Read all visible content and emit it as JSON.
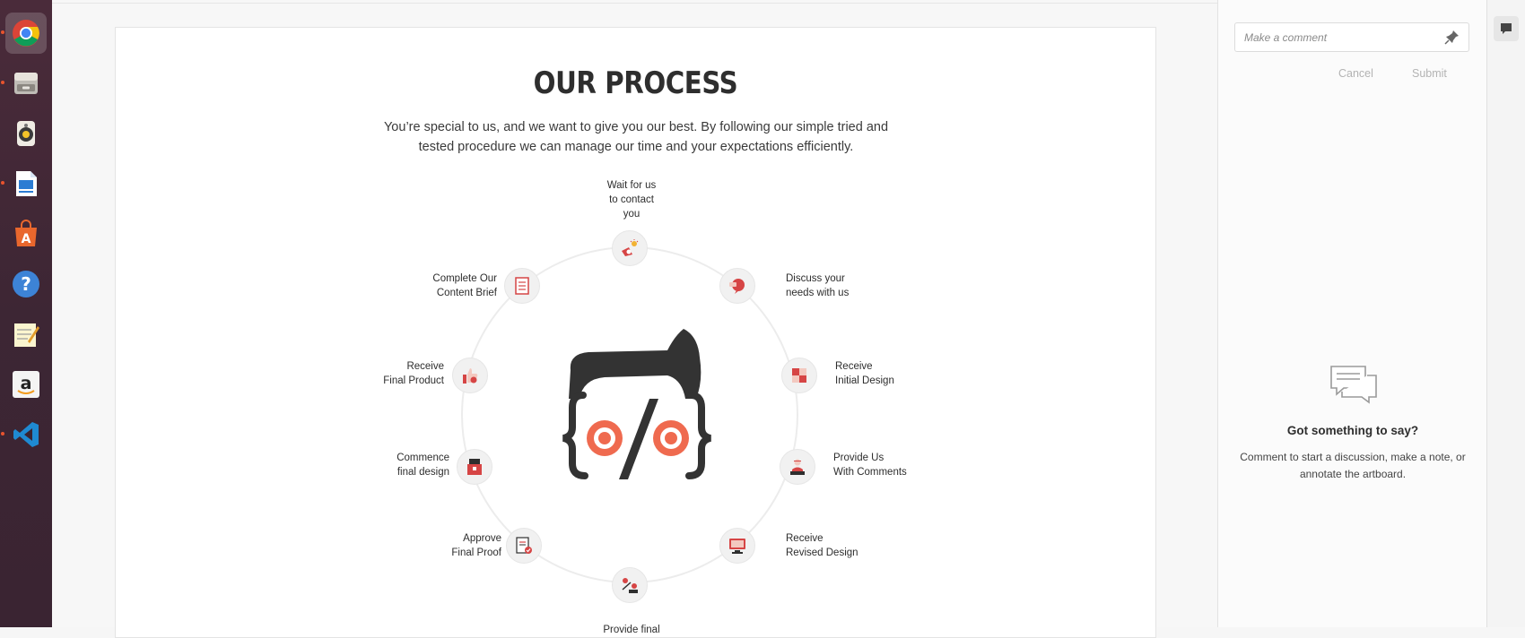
{
  "dock": {
    "apps": [
      {
        "name": "chrome-icon",
        "active": true,
        "running": true
      },
      {
        "name": "files-icon",
        "active": false,
        "running": true
      },
      {
        "name": "rhythmbox-icon",
        "active": false,
        "running": false
      },
      {
        "name": "writer-icon",
        "active": false,
        "running": true
      },
      {
        "name": "software-center-icon",
        "active": false,
        "running": false
      },
      {
        "name": "help-icon",
        "active": false,
        "running": false
      },
      {
        "name": "text-editor-icon",
        "active": false,
        "running": false
      },
      {
        "name": "amazon-icon",
        "active": false,
        "running": false
      },
      {
        "name": "vscode-icon",
        "active": false,
        "running": true
      }
    ]
  },
  "artboard": {
    "title": "OUR PROCESS",
    "intro": "You’re special to us, and we want to give you our best. By following our simple tried and tested procedure we can manage our time and your expectations efficiently.",
    "steps": [
      {
        "label": "Wait for us\nto contact you",
        "icon": "phone-bell-icon"
      },
      {
        "label": "Discuss your\nneeds with us",
        "icon": "speech-bubble-icon"
      },
      {
        "label": "Receive\nInitial Design",
        "icon": "puzzle-icon"
      },
      {
        "label": "Provide Us\nWith Comments",
        "icon": "person-stars-icon"
      },
      {
        "label": "Receive\nRevised Design",
        "icon": "monitor-icon"
      },
      {
        "label": "Provide final",
        "icon": "chat-users-icon"
      },
      {
        "label": "Approve\nFinal Proof",
        "icon": "approved-document-icon"
      },
      {
        "label": "Commence\nfinal design",
        "icon": "toolbox-icon"
      },
      {
        "label": "Receive\nFinal Product",
        "icon": "thumbs-up-icon"
      },
      {
        "label": "Complete Our\nContent Brief",
        "icon": "checklist-icon"
      }
    ],
    "logo": "code-face-logo",
    "accent_color": "#ef6a4f",
    "dark_color": "#333333"
  },
  "comments": {
    "placeholder": "Make a comment",
    "cancel_label": "Cancel",
    "submit_label": "Submit",
    "empty_title": "Got something to say?",
    "empty_text": "Comment to start a discussion, make a note, or annotate the artboard."
  }
}
